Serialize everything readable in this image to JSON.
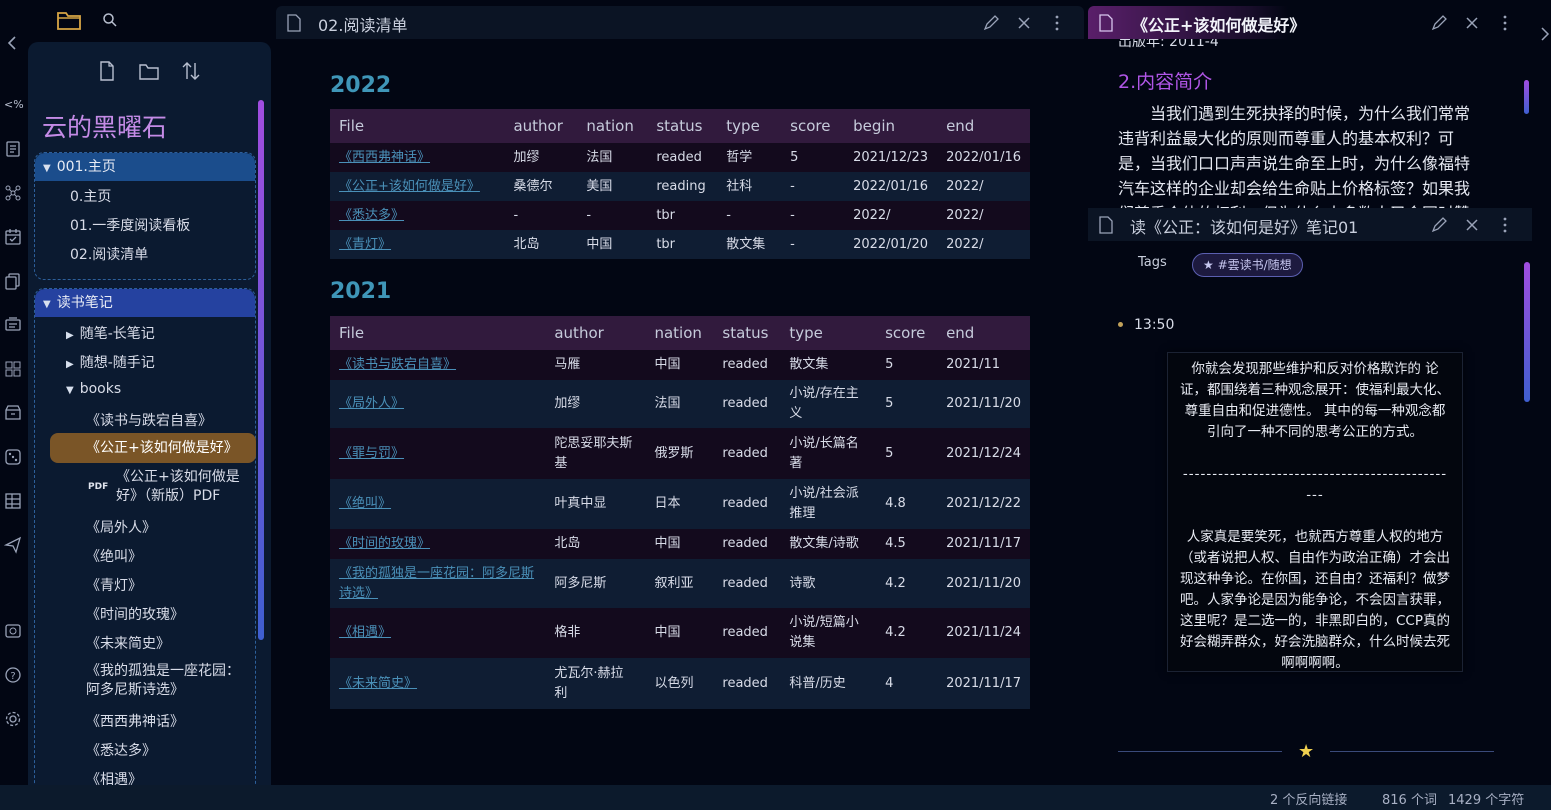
{
  "sidebar": {
    "vault_name": "云的黑曜石",
    "folders": [
      {
        "label": "001.主页",
        "files": [
          "0.主页",
          "01.一季度阅读看板",
          "02.阅读清单"
        ]
      },
      {
        "label": "读书笔记",
        "subfolders": [
          "随笔-长笔记",
          "随想-随手记",
          "books"
        ]
      }
    ],
    "books": [
      "《读书与跌宕自喜》",
      "《公正+该如何做是好》",
      "《公正+该如何做是好》（新版）PDF",
      "《局外人》",
      "《绝叫》",
      "《青灯》",
      "《时间的玫瑰》",
      "《未来简史》",
      "《我的孤独是一座花园：阿多尼斯诗选》",
      "《西西弗神话》",
      "《悉达多》",
      "《相遇》"
    ],
    "pdf_badge": "PDF"
  },
  "middle": {
    "title": "02.阅读清单",
    "year1": "2022",
    "table1": {
      "headers": [
        "File",
        "author",
        "nation",
        "status",
        "type",
        "score",
        "begin",
        "end"
      ],
      "rows": [
        [
          "《西西弗神话》",
          "加缪",
          "法国",
          "readed",
          "哲学",
          "5",
          "2021/12/23",
          "2022/01/16"
        ],
        [
          "《公正+该如何做是好》",
          "桑德尔",
          "美国",
          "reading",
          "社科",
          "-",
          "2022/01/16",
          "2022/"
        ],
        [
          "《悉达多》",
          "-",
          "-",
          "tbr",
          "-",
          "-",
          "2022/",
          "2022/"
        ],
        [
          "《青灯》",
          "北岛",
          "中国",
          "tbr",
          "散文集",
          "-",
          "2022/01/20",
          "2022/"
        ]
      ]
    },
    "year2": "2021",
    "table2": {
      "headers": [
        "File",
        "author",
        "nation",
        "status",
        "type",
        "score",
        "end"
      ],
      "rows": [
        [
          "《读书与跌宕自喜》",
          "马雁",
          "中国",
          "readed",
          "散文集",
          "5",
          "2021/11"
        ],
        [
          "《局外人》",
          "加缪",
          "法国",
          "readed",
          "小说/存在主义",
          "5",
          "2021/11/20"
        ],
        [
          "《罪与罚》",
          "陀思妥耶夫斯基",
          "俄罗斯",
          "readed",
          "小说/长篇名著",
          "5",
          "2021/12/24"
        ],
        [
          "《绝叫》",
          "叶真中显",
          "日本",
          "readed",
          "小说/社会派推理",
          "4.8",
          "2021/12/22"
        ],
        [
          "《时间的玫瑰》",
          "北岛",
          "中国",
          "readed",
          "散文集/诗歌",
          "4.5",
          "2021/11/17"
        ],
        [
          "《我的孤独是一座花园：阿多尼斯诗选》",
          "阿多尼斯",
          "叙利亚",
          "readed",
          "诗歌",
          "4.2",
          "2021/11/20"
        ],
        [
          "《相遇》",
          "格非",
          "中国",
          "readed",
          "小说/短篇小说集",
          "4.2",
          "2021/11/24"
        ],
        [
          "《未来简史》",
          "尤瓦尔·赫拉利",
          "以色列",
          "readed",
          "科普/历史",
          "4",
          "2021/11/17"
        ]
      ]
    }
  },
  "right_top": {
    "title": "《公正+该如何做是好》",
    "partial_line": "出版年: 2011-4",
    "heading": "2.内容简介",
    "paragraph": "当我们遇到生死抉择的时候，为什么我们常常违背利益最大化的原则而尊重人的基本权利？可是，当我们口口声声说生命至上时，为什么像福特汽车这样的企业却会给生命贴上价格标签？如果我们尊重个体的权利，但为什么大多数人又会同时赞成有时候"
  },
  "right_bottom": {
    "title": "读《公正：该如何是好》笔记01",
    "tags_label": "Tags",
    "tag": "★ #雲读书/随想",
    "time": "13:50",
    "note": {
      "p1": "你就会发现那些维护和反对价格欺诈的 论证，都围绕着三种观念展开：使福利最大化、尊重自由和促进德性。 其中的每一种观念都引向了一种不同的思考公正的方式。",
      "divider": "------------------------------------------------",
      "p2": "人家真是要笑死，也就西方尊重人权的地方（或者说把人权、自由作为政治正确）才会出现这种争论。在你国，还自由？还福利？做梦吧。人家争论是因为能争论，不会因言获罪，这里呢？是二选一的，非黑即白的，CCP真的好会糊弄群众，好会洗脑群众，什么时候去死啊啊啊啊。"
    },
    "separator_star": "★"
  },
  "status_bar": {
    "backlinks": "2 个反向链接",
    "words": "816 个词",
    "chars": "1429 个字符"
  },
  "colors": {
    "background": "#020613",
    "sidebar": "#0b1a30",
    "accent_purple": "#b056e6",
    "link_blue": "#4a90b8",
    "year_teal": "#3f96b8",
    "active_file": "#7a5527"
  }
}
